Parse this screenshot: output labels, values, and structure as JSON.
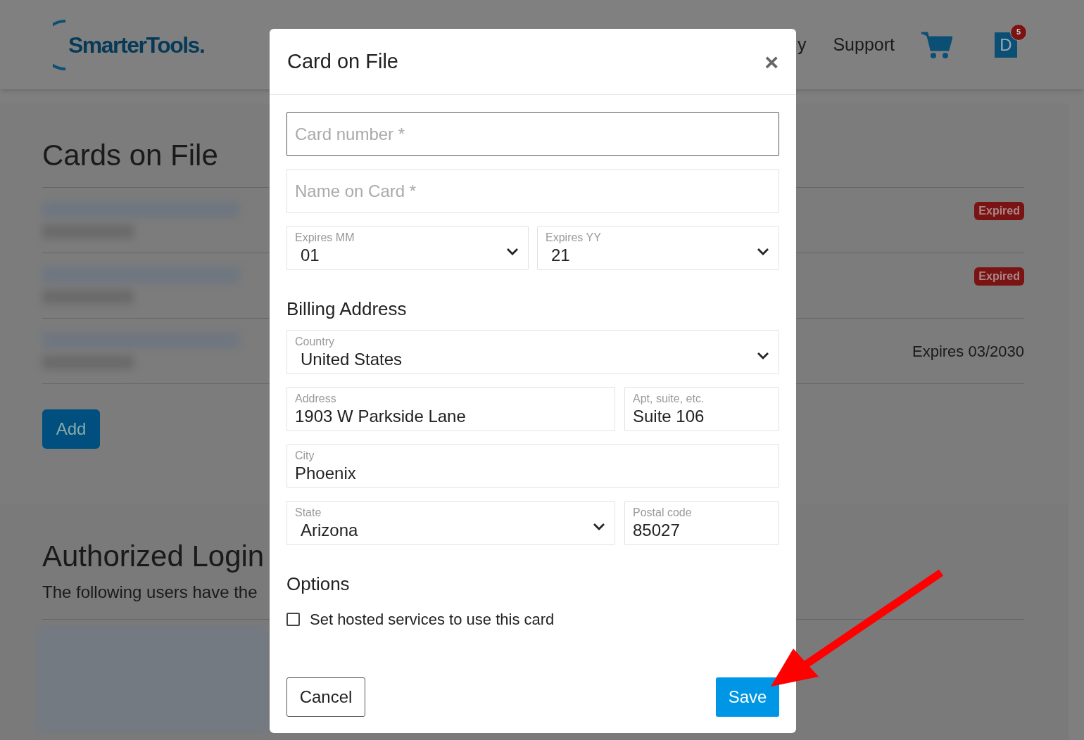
{
  "header": {
    "logo": "SmarterTools.",
    "nav": [
      "y",
      "Support"
    ],
    "avatar": {
      "letter": "D",
      "badge": "5"
    }
  },
  "cards_section": {
    "title": "Cards on File",
    "cards": [
      {
        "kind": "badge",
        "status": "Expired"
      },
      {
        "kind": "badge",
        "status": "Expired"
      },
      {
        "kind": "text",
        "status": "Expires 03/2030"
      }
    ],
    "add_button": "Add"
  },
  "logins_section": {
    "title": "Authorized Login",
    "description": "The following users have the"
  },
  "modal": {
    "title": "Card on File",
    "close": "×",
    "rows": [
      {
        "kind": "full",
        "fields": [
          {
            "kind": "input",
            "placeholder": "Card number *",
            "focused": true
          }
        ]
      },
      {
        "kind": "full",
        "fields": [
          {
            "kind": "input",
            "placeholder": "Name on Card *",
            "focused": false
          }
        ]
      },
      {
        "kind": "pair",
        "fields": [
          {
            "kind": "select",
            "label": "Expires MM",
            "value": "01"
          },
          {
            "kind": "select",
            "label": "Expires YY",
            "value": "21"
          }
        ]
      },
      {
        "kind": "heading",
        "text": "Billing Address"
      },
      {
        "kind": "full",
        "fields": [
          {
            "kind": "select",
            "label": "Country",
            "value": "United States"
          }
        ]
      },
      {
        "kind": "wide-narrow",
        "fields": [
          {
            "kind": "input",
            "label": "Address",
            "value": "1903 W Parkside Lane",
            "focused": false
          },
          {
            "kind": "input",
            "label": "Apt, suite, etc.",
            "value": "Suite 106",
            "focused": false
          }
        ]
      },
      {
        "kind": "full",
        "fields": [
          {
            "kind": "input",
            "label": "City",
            "value": "Phoenix",
            "focused": false
          }
        ]
      },
      {
        "kind": "wide-narrow",
        "fields": [
          {
            "kind": "select",
            "label": "State",
            "value": "Arizona"
          },
          {
            "kind": "input",
            "label": "Postal code",
            "value": "85027",
            "focused": false
          }
        ]
      },
      {
        "kind": "heading",
        "text": "Options"
      }
    ],
    "checkbox": {
      "label": "Set hosted services to use this card",
      "checked": false
    },
    "cancel": "Cancel",
    "save": "Save"
  }
}
